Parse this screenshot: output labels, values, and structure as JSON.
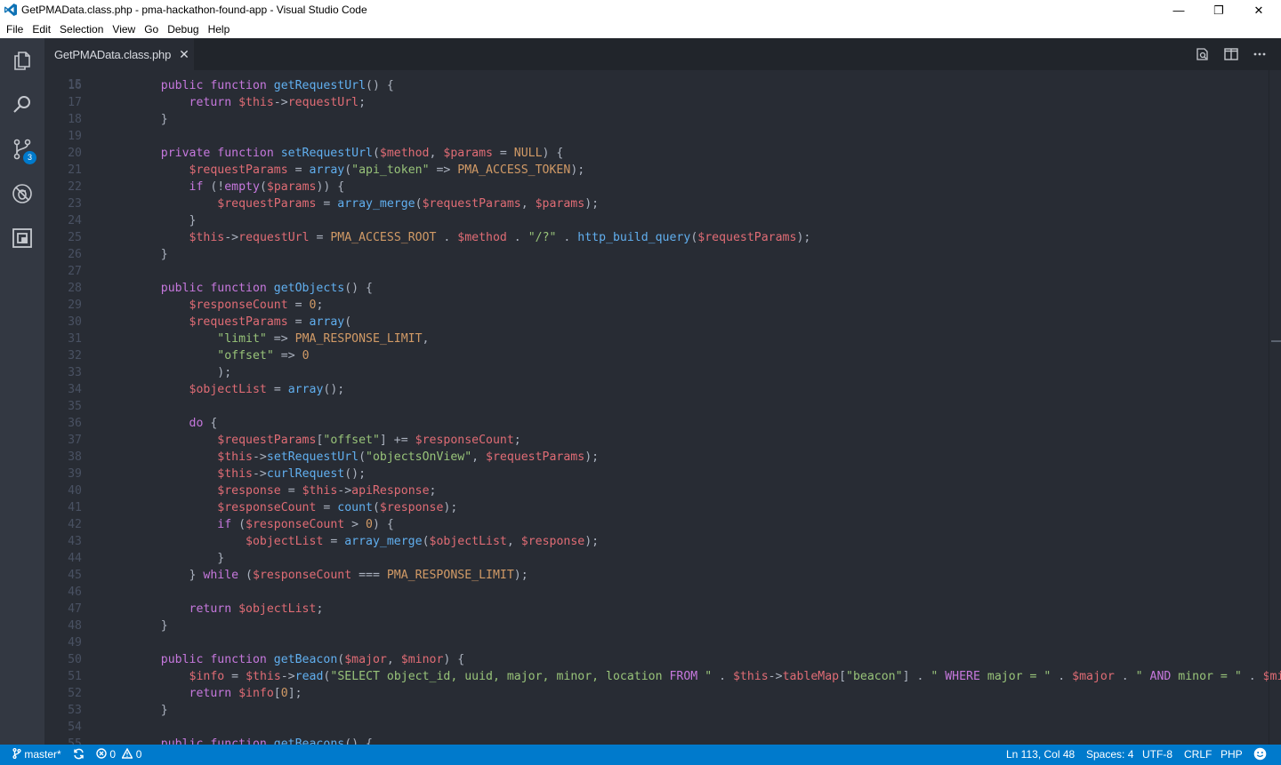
{
  "window": {
    "title": "GetPMAData.class.php - pma-hackathon-found-app - Visual Studio Code",
    "minimize": "—",
    "maximize": "❐",
    "close": "✕"
  },
  "menu": [
    "File",
    "Edit",
    "Selection",
    "View",
    "Go",
    "Debug",
    "Help"
  ],
  "activity": {
    "items": [
      "explorer-icon",
      "search-icon",
      "source-control-icon",
      "debug-icon",
      "extensions-icon"
    ],
    "scm_badge": "3"
  },
  "tab": {
    "label": "GetPMAData.class.php",
    "close": "✕"
  },
  "tab_actions": [
    "open-changes-icon",
    "split-editor-icon",
    "more-icon"
  ],
  "editor": {
    "partial_top_line": "15",
    "lines": [
      {
        "n": "16",
        "code": [
          [
            "    public function ",
            "k"
          ],
          [
            "getRequestUrl",
            "f"
          ],
          [
            "() {",
            "p"
          ]
        ]
      },
      {
        "n": "17",
        "code": [
          [
            "        return ",
            "k"
          ],
          [
            "$this",
            "v"
          ],
          [
            "->",
            "p"
          ],
          [
            "requestUrl",
            "v"
          ],
          [
            ";",
            "p"
          ]
        ]
      },
      {
        "n": "18",
        "code": [
          [
            "    }",
            "p"
          ]
        ]
      },
      {
        "n": "19",
        "code": []
      },
      {
        "n": "20",
        "code": [
          [
            "    private function ",
            "k"
          ],
          [
            "setRequestUrl",
            "f"
          ],
          [
            "(",
            "p"
          ],
          [
            "$method",
            "v"
          ],
          [
            ", ",
            "p"
          ],
          [
            "$params",
            "v"
          ],
          [
            " = ",
            "p"
          ],
          [
            "NULL",
            "c"
          ],
          [
            ") {",
            "p"
          ]
        ]
      },
      {
        "n": "21",
        "code": [
          [
            "        ",
            "p"
          ],
          [
            "$requestParams",
            "v"
          ],
          [
            " = ",
            "p"
          ],
          [
            "array",
            "f"
          ],
          [
            "(",
            "p"
          ],
          [
            "\"api_token\"",
            "s"
          ],
          [
            " => ",
            "p"
          ],
          [
            "PMA_ACCESS_TOKEN",
            "c"
          ],
          [
            ");",
            "p"
          ]
        ]
      },
      {
        "n": "22",
        "code": [
          [
            "        if ",
            "k"
          ],
          [
            "(!",
            "p"
          ],
          [
            "empty",
            "k"
          ],
          [
            "(",
            "p"
          ],
          [
            "$params",
            "v"
          ],
          [
            ")) {",
            "p"
          ]
        ]
      },
      {
        "n": "23",
        "code": [
          [
            "            ",
            "p"
          ],
          [
            "$requestParams",
            "v"
          ],
          [
            " = ",
            "p"
          ],
          [
            "array_merge",
            "f"
          ],
          [
            "(",
            "p"
          ],
          [
            "$requestParams",
            "v"
          ],
          [
            ", ",
            "p"
          ],
          [
            "$params",
            "v"
          ],
          [
            ");",
            "p"
          ]
        ]
      },
      {
        "n": "24",
        "code": [
          [
            "        }",
            "p"
          ]
        ]
      },
      {
        "n": "25",
        "code": [
          [
            "        ",
            "p"
          ],
          [
            "$this",
            "v"
          ],
          [
            "->",
            "p"
          ],
          [
            "requestUrl",
            "v"
          ],
          [
            " = ",
            "p"
          ],
          [
            "PMA_ACCESS_ROOT",
            "c"
          ],
          [
            " . ",
            "p"
          ],
          [
            "$method",
            "v"
          ],
          [
            " . ",
            "p"
          ],
          [
            "\"/?\"",
            "s"
          ],
          [
            " . ",
            "p"
          ],
          [
            "http_build_query",
            "f"
          ],
          [
            "(",
            "p"
          ],
          [
            "$requestParams",
            "v"
          ],
          [
            ");",
            "p"
          ]
        ]
      },
      {
        "n": "26",
        "code": [
          [
            "    }",
            "p"
          ]
        ]
      },
      {
        "n": "27",
        "code": []
      },
      {
        "n": "28",
        "code": [
          [
            "    public function ",
            "k"
          ],
          [
            "getObjects",
            "f"
          ],
          [
            "() {",
            "p"
          ]
        ]
      },
      {
        "n": "29",
        "code": [
          [
            "        ",
            "p"
          ],
          [
            "$responseCount",
            "v"
          ],
          [
            " = ",
            "p"
          ],
          [
            "0",
            "c"
          ],
          [
            ";",
            "p"
          ]
        ]
      },
      {
        "n": "30",
        "code": [
          [
            "        ",
            "p"
          ],
          [
            "$requestParams",
            "v"
          ],
          [
            " = ",
            "p"
          ],
          [
            "array",
            "f"
          ],
          [
            "(",
            "p"
          ]
        ]
      },
      {
        "n": "31",
        "code": [
          [
            "            ",
            "p"
          ],
          [
            "\"limit\"",
            "s"
          ],
          [
            " => ",
            "p"
          ],
          [
            "PMA_RESPONSE_LIMIT",
            "c"
          ],
          [
            ",",
            "p"
          ]
        ]
      },
      {
        "n": "32",
        "code": [
          [
            "            ",
            "p"
          ],
          [
            "\"offset\"",
            "s"
          ],
          [
            " => ",
            "p"
          ],
          [
            "0",
            "c"
          ]
        ]
      },
      {
        "n": "33",
        "code": [
          [
            "            );",
            "p"
          ]
        ]
      },
      {
        "n": "34",
        "code": [
          [
            "        ",
            "p"
          ],
          [
            "$objectList",
            "v"
          ],
          [
            " = ",
            "p"
          ],
          [
            "array",
            "f"
          ],
          [
            "();",
            "p"
          ]
        ]
      },
      {
        "n": "35",
        "code": []
      },
      {
        "n": "36",
        "code": [
          [
            "        do ",
            "k"
          ],
          [
            "{",
            "p"
          ]
        ]
      },
      {
        "n": "37",
        "code": [
          [
            "            ",
            "p"
          ],
          [
            "$requestParams",
            "v"
          ],
          [
            "[",
            "p"
          ],
          [
            "\"offset\"",
            "s"
          ],
          [
            "] += ",
            "p"
          ],
          [
            "$responseCount",
            "v"
          ],
          [
            ";",
            "p"
          ]
        ]
      },
      {
        "n": "38",
        "code": [
          [
            "            ",
            "p"
          ],
          [
            "$this",
            "v"
          ],
          [
            "->",
            "p"
          ],
          [
            "setRequestUrl",
            "f"
          ],
          [
            "(",
            "p"
          ],
          [
            "\"objectsOnView\"",
            "s"
          ],
          [
            ", ",
            "p"
          ],
          [
            "$requestParams",
            "v"
          ],
          [
            ");",
            "p"
          ]
        ]
      },
      {
        "n": "39",
        "code": [
          [
            "            ",
            "p"
          ],
          [
            "$this",
            "v"
          ],
          [
            "->",
            "p"
          ],
          [
            "curlRequest",
            "f"
          ],
          [
            "();",
            "p"
          ]
        ]
      },
      {
        "n": "40",
        "code": [
          [
            "            ",
            "p"
          ],
          [
            "$response",
            "v"
          ],
          [
            " = ",
            "p"
          ],
          [
            "$this",
            "v"
          ],
          [
            "->",
            "p"
          ],
          [
            "apiResponse",
            "v"
          ],
          [
            ";",
            "p"
          ]
        ]
      },
      {
        "n": "41",
        "code": [
          [
            "            ",
            "p"
          ],
          [
            "$responseCount",
            "v"
          ],
          [
            " = ",
            "p"
          ],
          [
            "count",
            "f"
          ],
          [
            "(",
            "p"
          ],
          [
            "$response",
            "v"
          ],
          [
            ");",
            "p"
          ]
        ]
      },
      {
        "n": "42",
        "code": [
          [
            "            if ",
            "k"
          ],
          [
            "(",
            "p"
          ],
          [
            "$responseCount",
            "v"
          ],
          [
            " > ",
            "p"
          ],
          [
            "0",
            "c"
          ],
          [
            ") {",
            "p"
          ]
        ]
      },
      {
        "n": "43",
        "code": [
          [
            "                ",
            "p"
          ],
          [
            "$objectList",
            "v"
          ],
          [
            " = ",
            "p"
          ],
          [
            "array_merge",
            "f"
          ],
          [
            "(",
            "p"
          ],
          [
            "$objectList",
            "v"
          ],
          [
            ", ",
            "p"
          ],
          [
            "$response",
            "v"
          ],
          [
            ");",
            "p"
          ]
        ]
      },
      {
        "n": "44",
        "code": [
          [
            "            }",
            "p"
          ]
        ]
      },
      {
        "n": "45",
        "code": [
          [
            "        } ",
            "p"
          ],
          [
            "while ",
            "k"
          ],
          [
            "(",
            "p"
          ],
          [
            "$responseCount",
            "v"
          ],
          [
            " === ",
            "p"
          ],
          [
            "PMA_RESPONSE_LIMIT",
            "c"
          ],
          [
            ");",
            "p"
          ]
        ]
      },
      {
        "n": "46",
        "code": []
      },
      {
        "n": "47",
        "code": [
          [
            "        return ",
            "k"
          ],
          [
            "$objectList",
            "v"
          ],
          [
            ";",
            "p"
          ]
        ]
      },
      {
        "n": "48",
        "code": [
          [
            "    }",
            "p"
          ]
        ]
      },
      {
        "n": "49",
        "code": []
      },
      {
        "n": "50",
        "code": [
          [
            "    public function ",
            "k"
          ],
          [
            "getBeacon",
            "f"
          ],
          [
            "(",
            "p"
          ],
          [
            "$major",
            "v"
          ],
          [
            ", ",
            "p"
          ],
          [
            "$minor",
            "v"
          ],
          [
            ") {",
            "p"
          ]
        ]
      },
      {
        "n": "51",
        "code": [
          [
            "        ",
            "p"
          ],
          [
            "$info",
            "v"
          ],
          [
            " = ",
            "p"
          ],
          [
            "$this",
            "v"
          ],
          [
            "->",
            "p"
          ],
          [
            "read",
            "f"
          ],
          [
            "(",
            "p"
          ],
          [
            "\"SELECT object_id, uuid, major, minor, location ",
            "s"
          ],
          [
            "FROM",
            "k"
          ],
          [
            " \"",
            "s"
          ],
          [
            " . ",
            "p"
          ],
          [
            "$this",
            "v"
          ],
          [
            "->",
            "p"
          ],
          [
            "tableMap",
            "v"
          ],
          [
            "[",
            "p"
          ],
          [
            "\"beacon\"",
            "s"
          ],
          [
            "] . ",
            "p"
          ],
          [
            "\" ",
            "s"
          ],
          [
            "WHERE",
            "k"
          ],
          [
            " major = \"",
            "s"
          ],
          [
            " . ",
            "p"
          ],
          [
            "$major",
            "v"
          ],
          [
            " . ",
            "p"
          ],
          [
            "\" ",
            "s"
          ],
          [
            "AND",
            "k"
          ],
          [
            " minor = \"",
            "s"
          ],
          [
            " . ",
            "p"
          ],
          [
            "$minor",
            "v"
          ],
          [
            ");",
            "p"
          ]
        ]
      },
      {
        "n": "52",
        "code": [
          [
            "        return ",
            "k"
          ],
          [
            "$info",
            "v"
          ],
          [
            "[",
            "p"
          ],
          [
            "0",
            "c"
          ],
          [
            "];",
            "p"
          ]
        ]
      },
      {
        "n": "53",
        "code": [
          [
            "    }",
            "p"
          ]
        ]
      },
      {
        "n": "54",
        "code": []
      },
      {
        "n": "55",
        "code": [
          [
            "    public function ",
            "k"
          ],
          [
            "getBeacons",
            "f"
          ],
          [
            "() {",
            "p"
          ]
        ]
      }
    ]
  },
  "status": {
    "branch": "master*",
    "errors": "0",
    "warnings": "0",
    "position": "Ln 113, Col 48",
    "spaces": "Spaces: 4",
    "encoding": "UTF-8",
    "eol": "CRLF",
    "language": "PHP"
  }
}
